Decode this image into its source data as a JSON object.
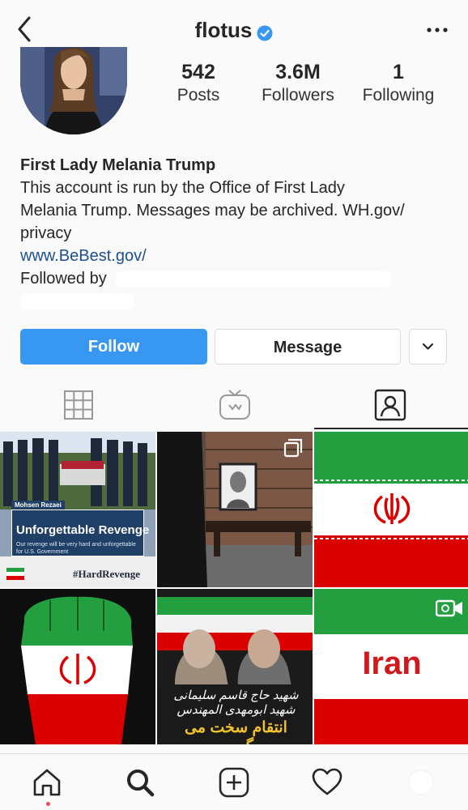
{
  "header": {
    "username": "flotus",
    "back_icon": "back-chevron-icon",
    "verified_icon": "verified-badge-icon",
    "more_icon": "more-options-icon"
  },
  "stats": {
    "posts": {
      "value": "542",
      "label": "Posts"
    },
    "followers": {
      "value": "3.6M",
      "label": "Followers"
    },
    "following": {
      "value": "1",
      "label": "Following"
    }
  },
  "bio": {
    "name": "First Lady Melania Trump",
    "lines": [
      "This account is run by the Office of First Lady",
      "Melania Trump. Messages may be archived. WH.gov/",
      "privacy"
    ],
    "link": "www.BeBest.gov/",
    "followed_by": "Followed by"
  },
  "buttons": {
    "follow": "Follow",
    "message": "Message",
    "dropdown_icon": "chevron-down-icon"
  },
  "tabs": [
    {
      "name": "grid",
      "icon": "grid-icon",
      "active": false
    },
    {
      "name": "igtv",
      "icon": "igtv-icon",
      "active": false
    },
    {
      "name": "tagged",
      "icon": "tagged-icon",
      "active": true
    }
  ],
  "posts": [
    {
      "subtitle": "Mohsen Rezaei",
      "title": "Unforgettable Revenge",
      "caption": "Our revenge will be very hard and unforgettable for U.S. Government",
      "hashtag": "#HardRevenge"
    },
    {
      "icon": "multiple-posts-icon"
    },
    {
      "icon": "iran-emblem"
    },
    {
      "icon": "iran-emblem"
    },
    {
      "arabic_line1": "شهید حاج قاسم سلیمانی شهید ابومهدی المهندس",
      "arabic_line2": "انتقام سخت می گیریم"
    },
    {
      "text": "Iran",
      "icon": "video-camera-icon"
    }
  ],
  "bottom_nav": [
    {
      "name": "home",
      "icon": "home-icon"
    },
    {
      "name": "search",
      "icon": "search-icon"
    },
    {
      "name": "new-post",
      "icon": "add-post-icon"
    },
    {
      "name": "activity",
      "icon": "heart-icon"
    },
    {
      "name": "profile",
      "icon": "profile-avatar-icon"
    }
  ],
  "colors": {
    "follow_button": "#3897f0",
    "link": "#1d4f91",
    "verified": "#3897f0",
    "iran_green": "#239f40",
    "iran_red": "#da0000",
    "notification_dot": "#ed4956"
  }
}
